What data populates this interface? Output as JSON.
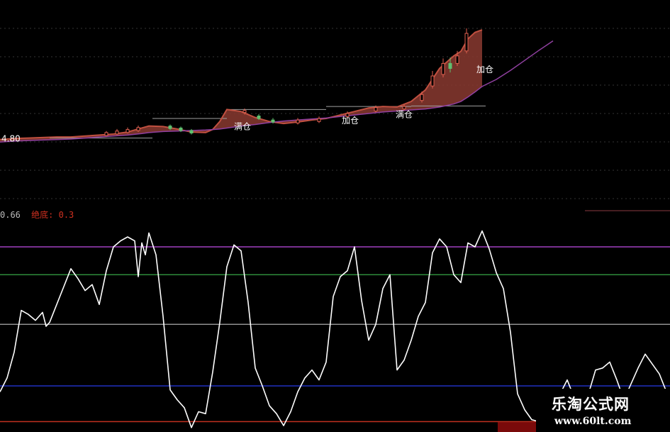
{
  "colors": {
    "background": "#000000",
    "grid": "#333333",
    "up_ribbon": "#c05040",
    "ribbon_fill": "#8a3a30",
    "ma_line": "#9040a0",
    "support": "#a0a0a0",
    "osc_line": "#ffffff",
    "level_top": "#a040c0",
    "level_upper": "#2e8b3a",
    "level_mid": "#909090",
    "level_low": "#2030c0",
    "level_bottom": "#c03020",
    "text_red": "#d03020",
    "text_grey": "#bbbbbb",
    "label": "#ffffff"
  },
  "info_bar": {
    "value": "0.66",
    "signal": "绝底: 0.3"
  },
  "price_labels": {
    "start_price": "4.80",
    "full": "满仓",
    "add": "加仓"
  },
  "watermark": {
    "title": "乐淘公式网",
    "url": "www.60lt.com"
  },
  "chart_data": [
    {
      "type": "line",
      "panel": "price",
      "ylim": [
        3.6,
        7.0
      ],
      "x": [
        0,
        20,
        40,
        60,
        80,
        100,
        120,
        140,
        160,
        180,
        200,
        210,
        230,
        250,
        270,
        290,
        300,
        310,
        320,
        340,
        360,
        380,
        400,
        420,
        440,
        460,
        480,
        500,
        520,
        540,
        560,
        580,
        600,
        620,
        640,
        650,
        660,
        670,
        680
      ],
      "series": [
        {
          "values": [
            4.78,
            4.8,
            4.81,
            4.82,
            4.83,
            4.83,
            4.85,
            4.87,
            4.89,
            4.93,
            5.01,
            5.05,
            5.04,
            4.99,
            4.93,
            4.92,
            4.98,
            5.14,
            5.38,
            5.34,
            5.22,
            5.14,
            5.1,
            5.13,
            5.17,
            5.2,
            5.27,
            5.34,
            5.41,
            5.44,
            5.43,
            5.54,
            5.77,
            6.2,
            6.45,
            6.54,
            6.79,
            6.92,
            6.97
          ]
        },
        {
          "values": [
            4.73,
            4.75,
            4.76,
            4.77,
            4.78,
            4.79,
            4.81,
            4.83,
            4.85,
            4.87,
            4.9,
            4.92,
            4.94,
            4.95,
            4.96,
            4.97,
            4.98,
            4.99,
            5.01,
            5.05,
            5.08,
            5.12,
            5.15,
            5.17,
            5.19,
            5.21,
            5.24,
            5.27,
            5.3,
            5.33,
            5.35,
            5.37,
            5.39,
            5.43,
            5.49,
            5.54,
            5.63,
            5.73,
            5.84
          ]
        }
      ],
      "ma_extension": {
        "x": [
          680,
          700,
          720,
          740,
          760,
          780
        ],
        "values": [
          5.84,
          5.98,
          6.16,
          6.36,
          6.56,
          6.75
        ]
      },
      "supports": [
        {
          "x": [
            70,
            215
          ],
          "y": 4.81
        },
        {
          "x": [
            215,
            320
          ],
          "y": 5.2
        },
        {
          "x": [
            320,
            460
          ],
          "y": 5.38
        },
        {
          "x": [
            460,
            580
          ],
          "y": 5.44
        },
        {
          "x": [
            580,
            685
          ],
          "y": 5.45
        }
      ],
      "markers": [
        {
          "x": 330,
          "y": 4.98,
          "label": "full"
        },
        {
          "x": 482,
          "y": 5.1,
          "label": "add"
        },
        {
          "x": 558,
          "y": 5.22,
          "label": "full"
        },
        {
          "x": 672,
          "y": 6.12,
          "label": "add"
        }
      ],
      "candles": [
        {
          "x": 150,
          "o": 4.86,
          "c": 4.92,
          "h": 4.95,
          "l": 4.84
        },
        {
          "x": 165,
          "o": 4.89,
          "c": 4.95,
          "h": 4.99,
          "l": 4.87
        },
        {
          "x": 180,
          "o": 4.92,
          "c": 4.98,
          "h": 5.02,
          "l": 4.9
        },
        {
          "x": 195,
          "o": 4.96,
          "c": 5.02,
          "h": 5.06,
          "l": 4.93
        },
        {
          "x": 240,
          "o": 5.05,
          "c": 5.0,
          "h": 5.08,
          "l": 4.97
        },
        {
          "x": 255,
          "o": 5.01,
          "c": 4.96,
          "h": 5.04,
          "l": 4.93
        },
        {
          "x": 270,
          "o": 4.96,
          "c": 4.91,
          "h": 4.99,
          "l": 4.88
        },
        {
          "x": 345,
          "o": 5.32,
          "c": 5.36,
          "h": 5.4,
          "l": 5.28
        },
        {
          "x": 365,
          "o": 5.25,
          "c": 5.2,
          "h": 5.29,
          "l": 5.17
        },
        {
          "x": 385,
          "o": 5.17,
          "c": 5.13,
          "h": 5.21,
          "l": 5.1
        },
        {
          "x": 420,
          "o": 5.11,
          "c": 5.17,
          "h": 5.21,
          "l": 5.08
        },
        {
          "x": 450,
          "o": 5.14,
          "c": 5.2,
          "h": 5.24,
          "l": 5.11
        },
        {
          "x": 490,
          "o": 5.24,
          "c": 5.3,
          "h": 5.34,
          "l": 5.21
        },
        {
          "x": 530,
          "o": 5.35,
          "c": 5.42,
          "h": 5.46,
          "l": 5.32
        },
        {
          "x": 570,
          "o": 5.39,
          "c": 5.44,
          "h": 5.48,
          "l": 5.36
        },
        {
          "x": 595,
          "o": 5.56,
          "c": 5.68,
          "h": 5.74,
          "l": 5.52
        },
        {
          "x": 610,
          "o": 5.85,
          "c": 6.05,
          "h": 6.15,
          "l": 5.8
        },
        {
          "x": 625,
          "o": 6.08,
          "c": 6.3,
          "h": 6.4,
          "l": 6.02
        },
        {
          "x": 635,
          "o": 6.3,
          "c": 6.2,
          "h": 6.42,
          "l": 6.12
        },
        {
          "x": 645,
          "o": 6.3,
          "c": 6.45,
          "h": 6.55,
          "l": 6.25
        },
        {
          "x": 658,
          "o": 6.55,
          "c": 6.9,
          "h": 7.0,
          "l": 6.5
        }
      ]
    },
    {
      "type": "line",
      "panel": "oscillator",
      "ylim": [
        0,
        100
      ],
      "levels": [
        {
          "y": 90,
          "key": "level_top"
        },
        {
          "y": 76,
          "key": "level_upper"
        },
        {
          "y": 51,
          "key": "level_mid"
        },
        {
          "y": 20,
          "key": "level_low"
        },
        {
          "y": 2,
          "key": "level_bottom"
        }
      ],
      "x": [
        0,
        10,
        20,
        30,
        40,
        50,
        60,
        65,
        70,
        80,
        90,
        100,
        110,
        120,
        130,
        140,
        150,
        160,
        170,
        180,
        190,
        195,
        200,
        205,
        210,
        220,
        230,
        240,
        250,
        260,
        270,
        280,
        290,
        300,
        310,
        320,
        330,
        340,
        350,
        360,
        370,
        380,
        390,
        400,
        410,
        420,
        430,
        440,
        450,
        460,
        470,
        480,
        490,
        500,
        510,
        520,
        530,
        540,
        550,
        560,
        570,
        580,
        590,
        600,
        610,
        620,
        630,
        640,
        650,
        660,
        670,
        680,
        690,
        700,
        710,
        720,
        730,
        740,
        750,
        760,
        770,
        780,
        790,
        800,
        810,
        820,
        830,
        840,
        850,
        860,
        870,
        880,
        890,
        900,
        910,
        920,
        930,
        940
      ],
      "values": [
        17,
        24,
        37,
        58,
        56,
        53,
        57,
        50,
        52,
        61,
        70,
        79,
        74,
        68,
        71,
        61,
        78,
        90,
        93,
        95,
        93,
        75,
        92,
        86,
        97,
        86,
        55,
        18,
        13,
        9,
        -1,
        7,
        6,
        27,
        52,
        80,
        91,
        88,
        62,
        29,
        20,
        10,
        6,
        0,
        7,
        17,
        24,
        28,
        23,
        32,
        65,
        75,
        78,
        90,
        63,
        43,
        51,
        69,
        76,
        28,
        33,
        43,
        55,
        62,
        87,
        94,
        90,
        76,
        72,
        92,
        90,
        98,
        89,
        77,
        69,
        47,
        16,
        8,
        3,
        2,
        4,
        10,
        16,
        23,
        14,
        10,
        16,
        28,
        29,
        32,
        23,
        13,
        21,
        29,
        36,
        31,
        26,
        17
      ]
    }
  ]
}
